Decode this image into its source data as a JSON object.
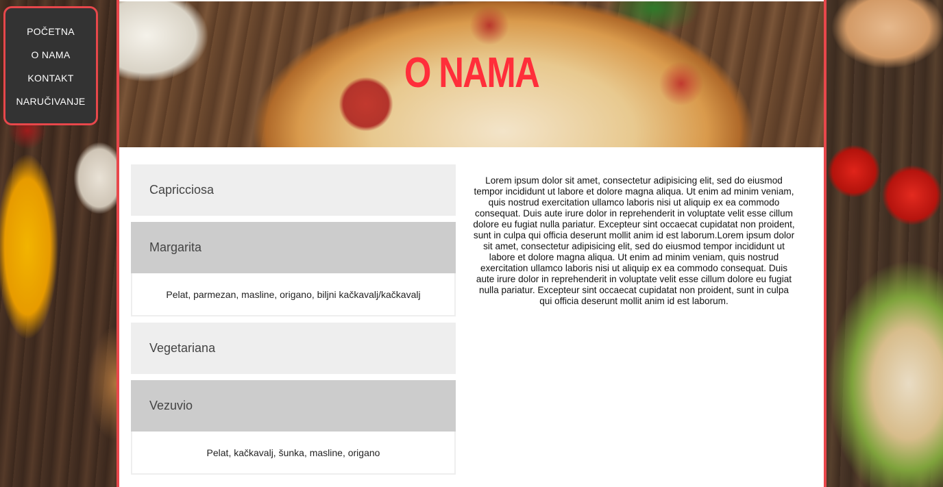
{
  "nav": {
    "items": [
      "POČETNA",
      "O NAMA",
      "KONTAKT",
      "NARUČIVANJE"
    ]
  },
  "hero": {
    "title": "O NAMA"
  },
  "accordion": {
    "items": [
      {
        "title": "Capricciosa",
        "content": "",
        "open": false
      },
      {
        "title": "Margarita",
        "content": "Pelat, parmezan, masline, origano, biljni kačkavalj/kačkavalj",
        "open": true
      },
      {
        "title": "Vegetariana",
        "content": "",
        "open": false
      },
      {
        "title": "Vezuvio",
        "content": "Pelat, kačkavalj, šunka, masline, origano",
        "open": true
      }
    ]
  },
  "about": {
    "text": "Lorem ipsum dolor sit amet, consectetur adipisicing elit, sed do eiusmod tempor incididunt ut labore et dolore magna aliqua. Ut enim ad minim veniam, quis nostrud exercitation ullamco laboris nisi ut aliquip ex ea commodo consequat. Duis aute irure dolor in reprehenderit in voluptate velit esse cillum dolore eu fugiat nulla pariatur. Excepteur sint occaecat cupidatat non proident, sunt in culpa qui officia deserunt mollit anim id est laborum.Lorem ipsum dolor sit amet, consectetur adipisicing elit, sed do eiusmod tempor incididunt ut labore et dolore magna aliqua. Ut enim ad minim veniam, quis nostrud exercitation ullamco laboris nisi ut aliquip ex ea commodo consequat. Duis aute irure dolor in reprehenderit in voluptate velit esse cillum dolore eu fugiat nulla pariatur. Excepteur sint occaecat cupidatat non proident, sunt in culpa qui officia deserunt mollit anim id est laborum."
  },
  "colors": {
    "accent": "#e8474b",
    "title": "#ff2e3a",
    "nav_bg": "#333333",
    "accordion_closed": "#eeeeee",
    "accordion_open": "#cccccc"
  }
}
